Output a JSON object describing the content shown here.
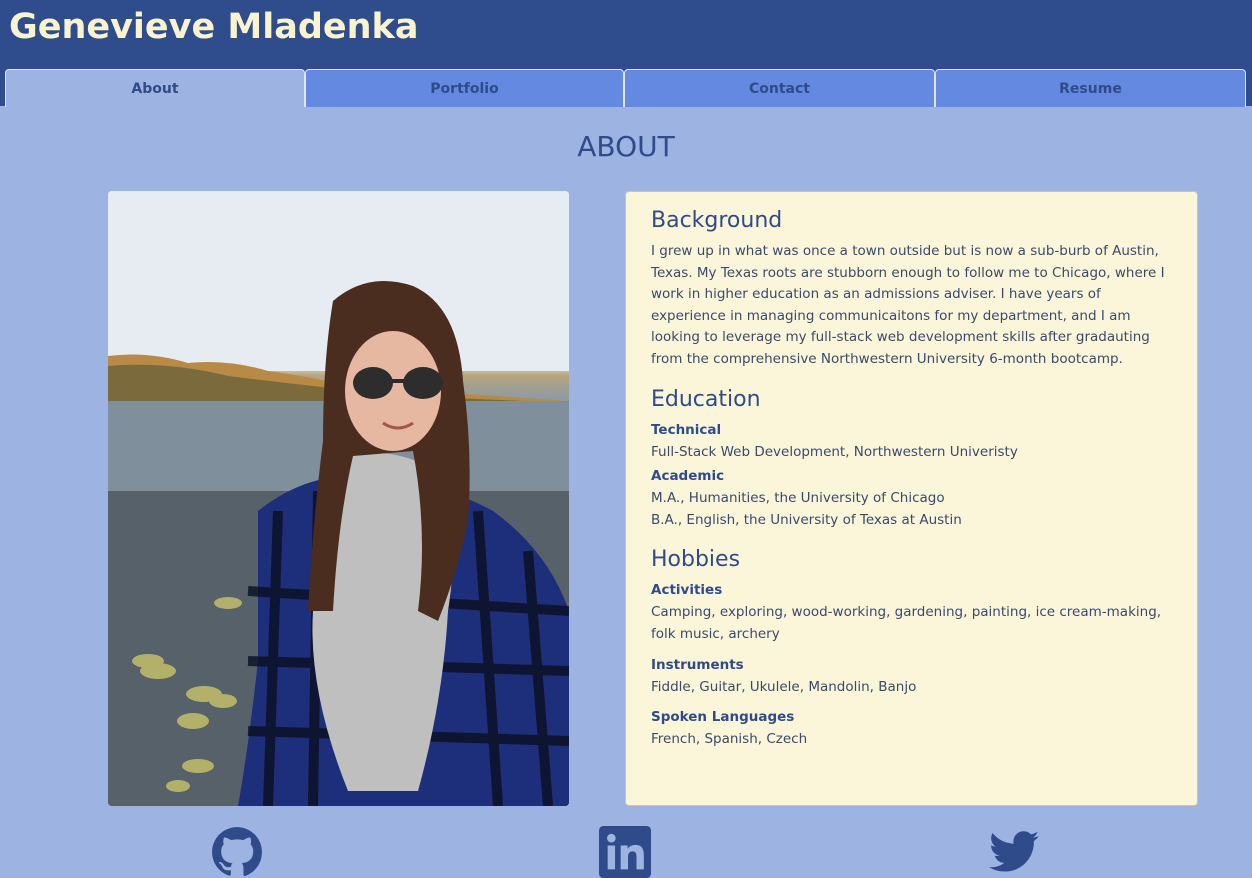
{
  "header": {
    "site_title": "Genevieve Mladenka"
  },
  "nav": {
    "tabs": [
      {
        "label": "About"
      },
      {
        "label": "Portfolio"
      },
      {
        "label": "Contact"
      },
      {
        "label": "Resume"
      }
    ],
    "active": "About"
  },
  "main": {
    "heading": "ABOUT",
    "photo_icon": "profile-photo",
    "background": {
      "title": "Background",
      "text": "I grew up in what was once a town outside but is now a sub-burb of Austin, Texas. My Texas roots are stubborn enough to follow me to Chicago, where I work in higher education as an admissions adviser. I have years of experience in managing communicaitons for my department, and I am looking to leverage my full-stack web development skills after gradauting from the comprehensive Northwestern University 6-month bootcamp."
    },
    "education": {
      "title": "Education",
      "technical_label": "Technical",
      "technical_items": [
        "Full-Stack Web Development, Northwestern Univeristy"
      ],
      "academic_label": "Academic",
      "academic_items": [
        "M.A., Humanities, the University of Chicago",
        "B.A., English, the University of Texas at Austin"
      ]
    },
    "hobbies": {
      "title": "Hobbies",
      "activities_label": "Activities",
      "activities": "Camping, exploring, wood-working, gardening, painting, ice cream-making, folk music, archery",
      "instruments_label": "Instruments",
      "instruments": "Fiddle, Guitar, Ukulele, Mandolin, Banjo",
      "languages_label": "Spoken Languages",
      "languages": "French, Spanish, Czech"
    }
  },
  "footer": {
    "icons": [
      "github-icon",
      "linkedin-icon",
      "twitter-icon"
    ]
  },
  "colors": {
    "page_bg": "#9db4e3",
    "header_bg": "#2f4d8c",
    "title": "#f9f3cf",
    "tab": "#6489e1",
    "card_bg": "#fbf6da",
    "accent": "#2f4b8a"
  }
}
